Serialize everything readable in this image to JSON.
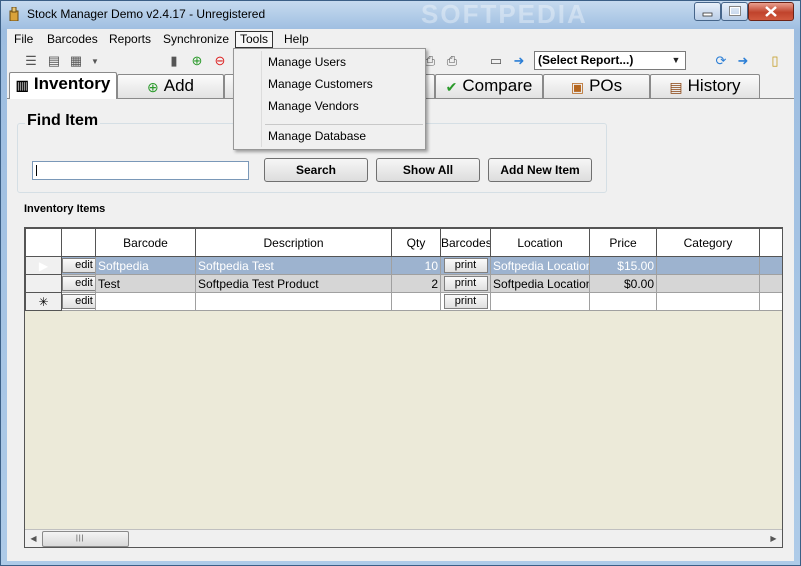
{
  "window": {
    "title": "Stock Manager Demo v2.4.17 - Unregistered",
    "watermark": "SOFTPEDIA"
  },
  "menu": {
    "items": [
      "File",
      "Barcodes",
      "Reports",
      "Synchronize",
      "Tools",
      "Help"
    ],
    "active": "Tools"
  },
  "tools_menu": {
    "items": [
      "Manage Users",
      "Manage Customers",
      "Manage Vendors",
      "Manage Database"
    ]
  },
  "toolbar": {
    "report_select": "(Select Report...)"
  },
  "tabs": [
    {
      "label": "Inventory",
      "icon": "barcode-icon"
    },
    {
      "label": "Add",
      "icon": "plus-icon"
    },
    {
      "label": "Compare",
      "icon": "check-icon"
    },
    {
      "label": "POs",
      "icon": "po-icon"
    },
    {
      "label": "History",
      "icon": "history-icon"
    }
  ],
  "find": {
    "title": "Find Item",
    "search_value": "",
    "search_button": "Search",
    "show_all_button": "Show All",
    "add_new_button": "Add New Item"
  },
  "grid": {
    "label": "Inventory Items",
    "columns": [
      "",
      "",
      "Barcode",
      "Description",
      "Qty",
      "Barcodes",
      "Location",
      "Price",
      "Category",
      ""
    ],
    "rows": [
      {
        "edit": "edit",
        "barcode": "Softpedia",
        "description": "Softpedia Test",
        "qty": "10",
        "print": "print",
        "location": "Softpedia Location",
        "price": "$15.00",
        "category": ""
      },
      {
        "edit": "edit",
        "barcode": "Test",
        "description": "Softpedia Test Product",
        "qty": "2",
        "print": "print",
        "location": "Softpedia Location",
        "price": "$0.00",
        "category": ""
      }
    ],
    "new_row": {
      "edit": "edit",
      "print": "print"
    },
    "row_marker": "▶",
    "new_marker": "✳"
  },
  "colors": {
    "selected_row": "#9db3cf",
    "title_gradient": "#9dbde0",
    "close_button": "#c0432c"
  }
}
